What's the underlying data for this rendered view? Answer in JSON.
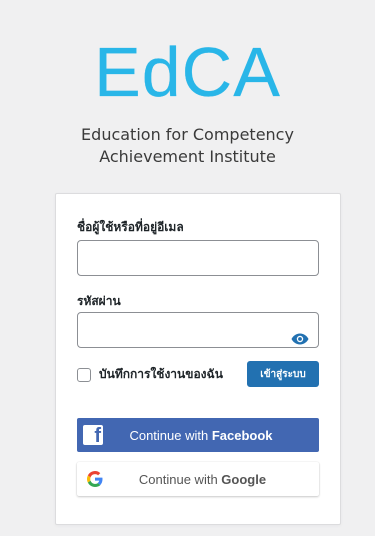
{
  "brand": {
    "logo_text": "EdCA",
    "subtitle_line1": "Education for Competency",
    "subtitle_line2": "Achievement Institute",
    "logo_color": "#29b6e8"
  },
  "login_form": {
    "username_label": "ชื่อผู้ใช้หรือที่อยู่อีเมล",
    "username_value": "",
    "password_label": "รหัสผ่าน",
    "password_value": "",
    "remember_label": "บันทึกการใช้งานของฉัน",
    "remember_checked": false,
    "submit_label": "เข้าสู่ระบบ"
  },
  "social_login": {
    "facebook_prefix": "Continue with ",
    "facebook_brand": "Facebook",
    "google_prefix": "Continue with ",
    "google_brand": "Google"
  },
  "colors": {
    "background": "#f0f0f1",
    "primary_button": "#2271b1",
    "facebook": "#4267b2"
  },
  "icons": {
    "password_toggle": "eye-icon",
    "facebook": "facebook-logo-icon",
    "google": "google-logo-icon"
  }
}
